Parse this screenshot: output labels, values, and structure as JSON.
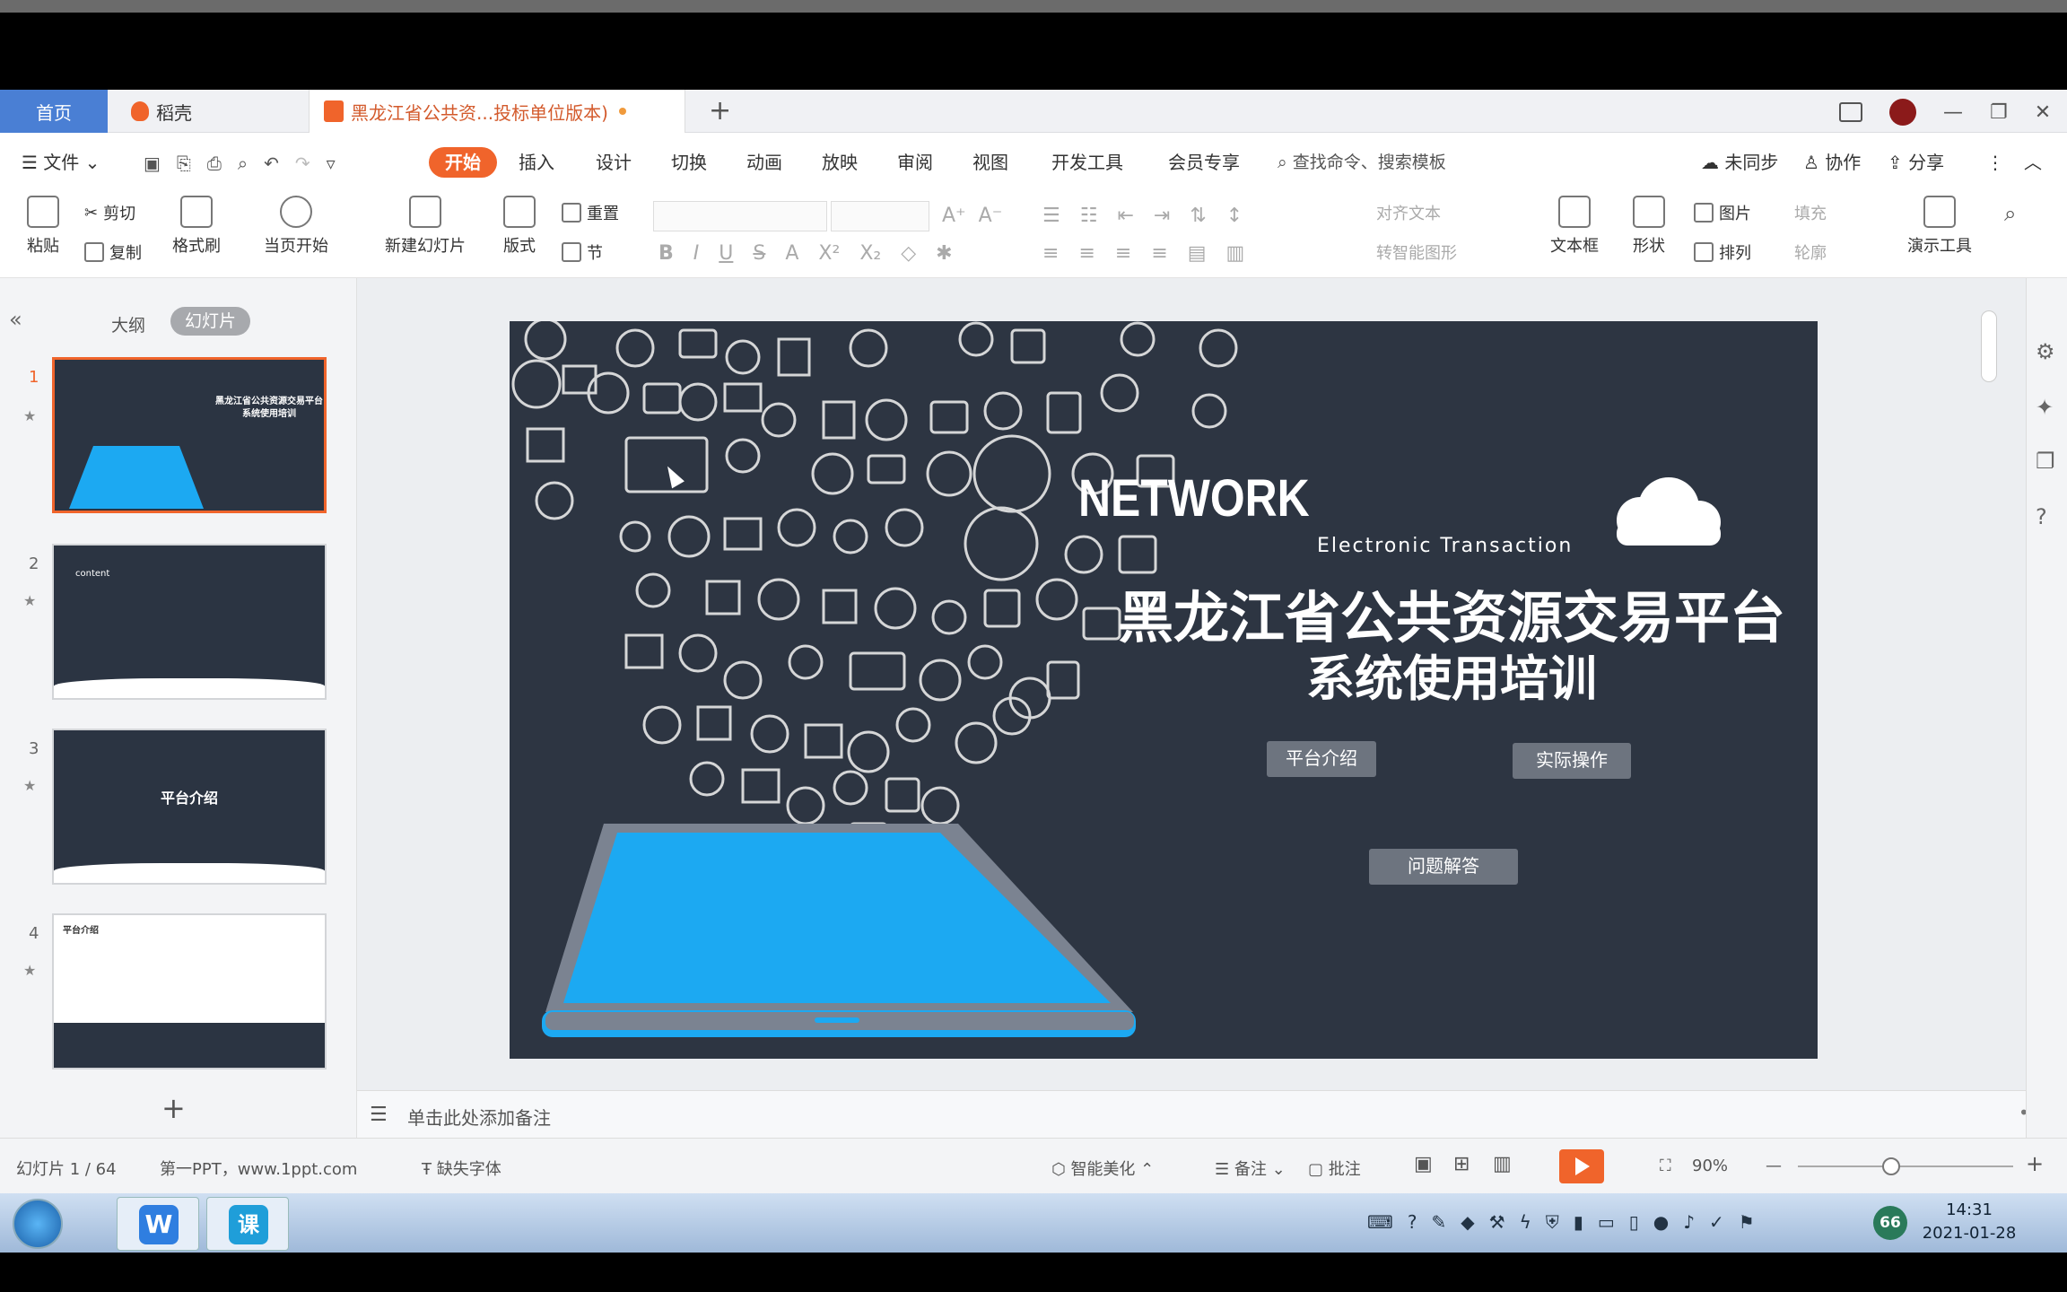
{
  "tabs": {
    "home": "首页",
    "docer": "稻壳",
    "document": "黑龙江省公共资...投标单位版本)"
  },
  "menu": {
    "file": "文件",
    "items": [
      "开始",
      "插入",
      "设计",
      "切换",
      "动画",
      "放映",
      "审阅",
      "视图",
      "开发工具",
      "会员专享"
    ],
    "search_placeholder": "查找命令、搜索模板",
    "sync": "未同步",
    "collab": "协作",
    "share": "分享"
  },
  "ribbon": {
    "paste": "粘贴",
    "cut": "剪切",
    "copy": "复制",
    "format_painter": "格式刷",
    "from_current": "当页开始",
    "new_slide": "新建幻灯片",
    "layout": "版式",
    "reset": "重置",
    "section": "节",
    "align_text": "对齐文本",
    "smart_shape": "转智能图形",
    "textbox": "文本框",
    "shape": "形状",
    "picture": "图片",
    "arrange": "排列",
    "fill": "填充",
    "outline": "轮廓",
    "present_tools": "演示工具"
  },
  "left_panel": {
    "outline_tab": "大纲",
    "slides_tab": "幻灯片",
    "thumbnails": [
      {
        "num": "1",
        "title": "黑龙江省公共资源交易平台系统使用培训"
      },
      {
        "num": "2",
        "title": "content"
      },
      {
        "num": "3",
        "title": "平台介绍"
      },
      {
        "num": "4",
        "title": "平台介绍"
      }
    ],
    "add": "+"
  },
  "slide": {
    "network": "NETWORK",
    "subtitle": "Electronic Transaction",
    "title_line1": "黑龙江省公共资源交易平台",
    "title_line2": "系统使用培训",
    "btn1": "平台介绍",
    "btn2": "实际操作",
    "btn3": "问题解答"
  },
  "notes": {
    "placeholder": "单击此处添加备注"
  },
  "status": {
    "slide_count": "幻灯片 1 / 64",
    "theme": "第一PPT，www.1ppt.com",
    "missing_font": "缺失字体",
    "beautify": "智能美化",
    "notes": "备注",
    "comments": "批注",
    "zoom": "90%"
  },
  "taskbar": {
    "time": "14:31",
    "date": "2021-01-28",
    "badge": "66"
  },
  "colors": {
    "accent": "#f0642b",
    "slide_bg": "#2d3542",
    "tablet_screen": "#1ca9f2"
  }
}
